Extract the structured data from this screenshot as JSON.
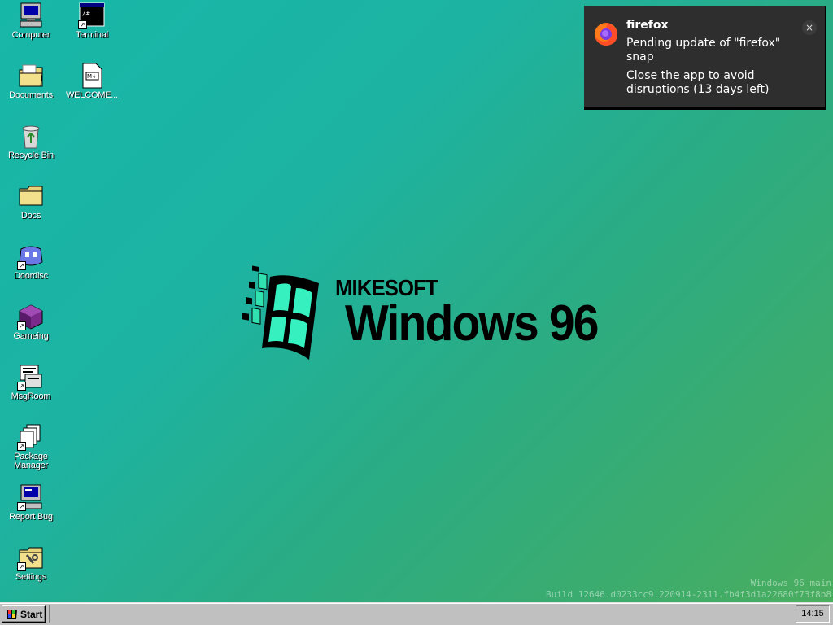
{
  "desktop": {
    "icons": [
      {
        "label": "Computer",
        "icon": "computer-icon"
      },
      {
        "label": "Terminal",
        "icon": "terminal-icon"
      },
      {
        "label": "Documents",
        "icon": "documents-folder-icon"
      },
      {
        "label": "WELCOME...",
        "icon": "markdown-file-icon"
      },
      {
        "label": "Recycle Bin",
        "icon": "recycle-bin-icon"
      },
      {
        "label": "Docs",
        "icon": "folder-icon"
      },
      {
        "label": "Doordisc",
        "icon": "doordisc-icon"
      },
      {
        "label": "Gameing",
        "icon": "cube-icon"
      },
      {
        "label": "MsgRoom",
        "icon": "msgroom-icon"
      },
      {
        "label": "Package Manager",
        "icon": "package-manager-icon"
      },
      {
        "label": "Report Bug",
        "icon": "report-bug-icon"
      },
      {
        "label": "Settings",
        "icon": "settings-icon"
      }
    ],
    "logo": {
      "brand": "MIKESOFT",
      "product": "Windows 96"
    },
    "build": {
      "line1": "Windows 96 main",
      "line2": "Build 12646.d0233cc9.220914-2311.fb4f3d1a22680f73f8b8"
    }
  },
  "notification": {
    "app": "firefox",
    "icon": "firefox-icon",
    "message1": "Pending update of \"firefox\" snap",
    "message2": "Close the app to avoid disruptions (13 days left)",
    "close_label": "×"
  },
  "taskbar": {
    "start_label": "Start",
    "clock": "14:15"
  },
  "colors": {
    "desktop_gradient_start": "#17b7a8",
    "desktop_gradient_end": "#49ad5e",
    "notification_bg": "#2e2e2e",
    "taskbar_bg": "#c0c0c0"
  }
}
